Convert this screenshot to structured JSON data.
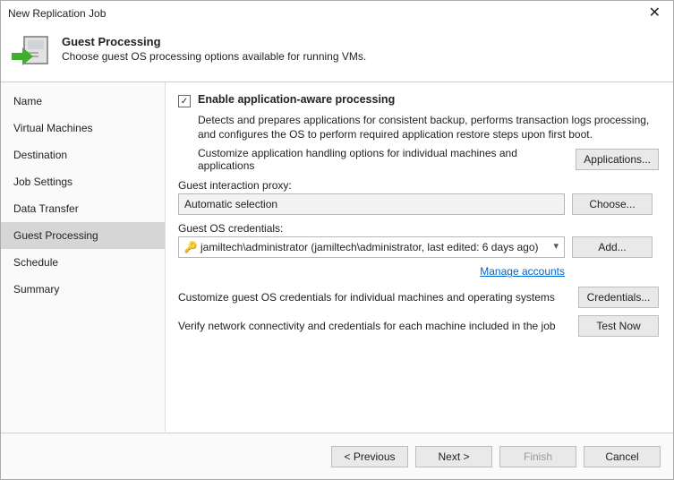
{
  "window": {
    "title": "New Replication Job"
  },
  "header": {
    "title": "Guest Processing",
    "subtitle": "Choose guest OS processing options available for running VMs."
  },
  "sidebar": {
    "items": [
      {
        "label": "Name"
      },
      {
        "label": "Virtual Machines"
      },
      {
        "label": "Destination"
      },
      {
        "label": "Job Settings"
      },
      {
        "label": "Data Transfer"
      },
      {
        "label": "Guest Processing"
      },
      {
        "label": "Schedule"
      },
      {
        "label": "Summary"
      }
    ],
    "selected": 5
  },
  "main": {
    "enable_label": "Enable application-aware processing",
    "enable_desc": "Detects and prepares applications for consistent backup, performs transaction logs processing, and configures the OS to perform required application restore steps upon first boot.",
    "customize_apps_text": "Customize application handling options for individual machines and applications",
    "applications_btn": "Applications...",
    "proxy_label": "Guest interaction proxy:",
    "proxy_value": "Automatic selection",
    "choose_btn": "Choose...",
    "creds_label": "Guest OS credentials:",
    "creds_value": "jamiltech\\administrator (jamiltech\\administrator, last edited: 6 days ago)",
    "add_btn": "Add...",
    "manage_link": "Manage accounts",
    "customize_creds_text": "Customize guest OS credentials for individual machines and operating systems",
    "credentials_btn": "Credentials...",
    "verify_text": "Verify network connectivity and credentials for each machine included in the job",
    "test_btn": "Test Now"
  },
  "footer": {
    "previous": "< Previous",
    "next": "Next >",
    "finish": "Finish",
    "cancel": "Cancel"
  }
}
